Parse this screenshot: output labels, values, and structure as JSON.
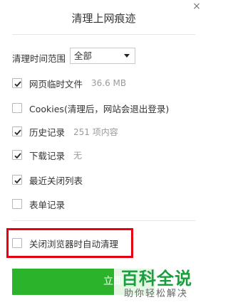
{
  "dialog": {
    "title": "清理上网痕迹",
    "close_glyph": "×"
  },
  "range": {
    "label": "清理时间范围",
    "selected": "全部"
  },
  "items": [
    {
      "label": "网页临时文件",
      "meta": "36.6 MB",
      "checked": true
    },
    {
      "label": "Cookies(清理后，网站会退出登录)",
      "meta": "",
      "checked": false
    },
    {
      "label": "历史记录",
      "meta": "251 项内容",
      "checked": true
    },
    {
      "label": "下载记录",
      "meta": "无",
      "checked": true
    },
    {
      "label": "最近关闭列表",
      "meta": "",
      "checked": true
    },
    {
      "label": "表单记录",
      "meta": "",
      "checked": false
    }
  ],
  "auto_clean": {
    "label": "关闭浏览器时自动清理",
    "checked": false
  },
  "button": {
    "label": "立即清"
  },
  "watermark": {
    "title": "百科全说",
    "subtitle": "助你轻松解决"
  },
  "colors": {
    "accent": "#2bb32b",
    "highlight": "#e60012",
    "watermark": "#1b9e3d"
  }
}
